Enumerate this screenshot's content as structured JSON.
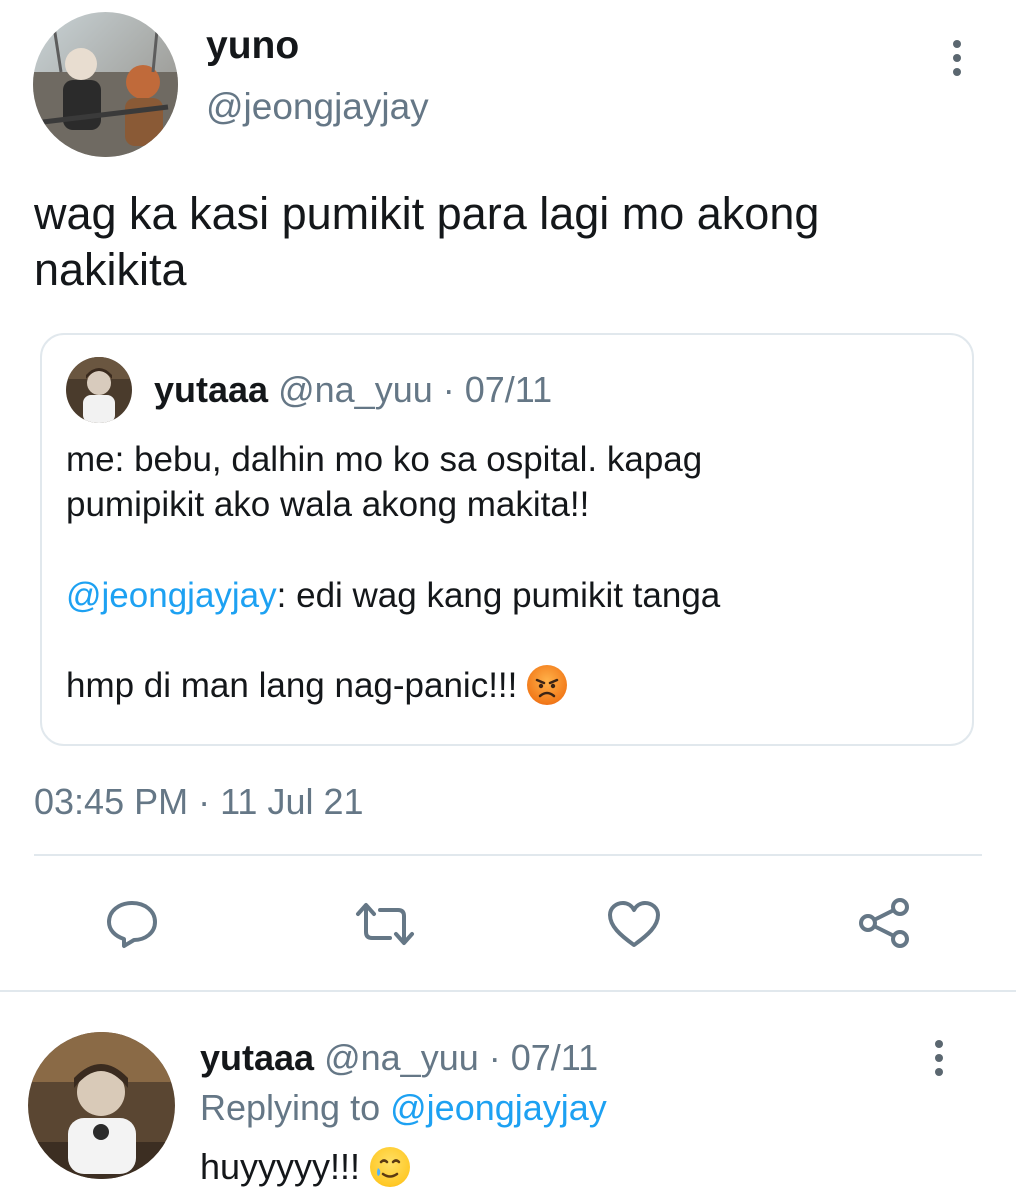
{
  "main_tweet": {
    "display_name": "yuno",
    "handle": "@jeongjayjay",
    "text_line1": "wag ka kasi pumikit para lagi mo akong",
    "text_line2": "nakikita",
    "timestamp": "03:45 PM · 11 Jul 21"
  },
  "quoted_tweet": {
    "display_name": "yutaaa",
    "handle": "@na_yuu",
    "date": "· 07/11",
    "line1": "me: bebu, dalhin mo ko sa ospital. kapag",
    "line2": "pumipikit ako wala akong makita!!",
    "mention": "@jeongjayjay",
    "line3_rest": ": edi wag kang pumikit tanga",
    "line4": "hmp di man lang nag-panic!!!",
    "emoji": "angry-face"
  },
  "actions": {
    "reply": "reply-icon",
    "retweet": "retweet-icon",
    "like": "heart-icon",
    "share": "share-icon"
  },
  "reply_tweet": {
    "display_name": "yutaaa",
    "handle": "@na_yuu",
    "date": "· 07/11",
    "replying_to_label": "Replying to",
    "replying_to_handle": "@jeongjayjay",
    "text": "huyyyyy!!!",
    "emoji": "sad-relieved-face"
  },
  "colors": {
    "link": "#1da1f2",
    "muted": "#657786",
    "text": "#14171a",
    "border": "#e1e8ed"
  }
}
